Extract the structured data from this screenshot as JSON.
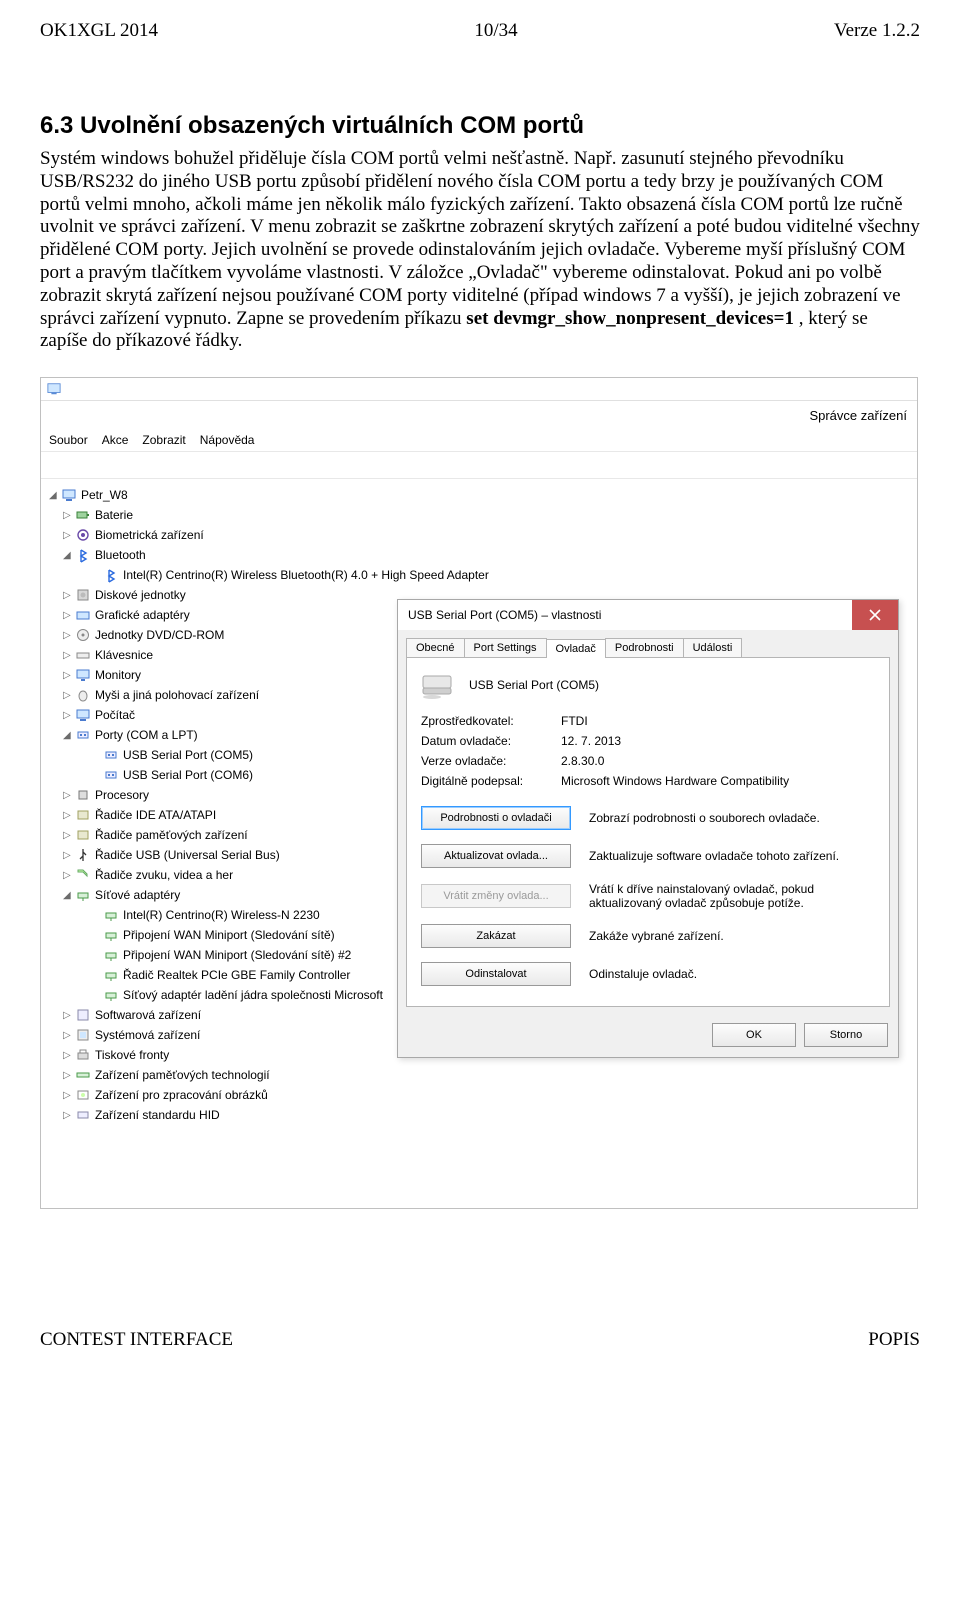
{
  "doc": {
    "header_left": "OK1XGL 2014",
    "header_center": "10/34",
    "header_right": "Verze 1.2.2",
    "section_title": "6.3  Uvolnění obsazených virtuálních COM portů",
    "paragraph_pre": "Systém windows bohužel přiděluje čísla COM portů velmi nešťastně. Např. zasunutí stejného převodníku USB/RS232 do jiného USB portu způsobí přidělení nového čísla COM portu a tedy brzy je používaných COM portů velmi mnoho, ačkoli máme jen několik málo fyzických zařízení. Takto obsazená čísla COM portů lze ručně uvolnit ve správci zařízení. V menu zobrazit se zaškrtne zobrazení skrytých zařízení a poté budou viditelné všechny přidělené COM porty. Jejich uvolnění se provede odinstalováním jejich ovladače. Vybereme myší příslušný COM port a pravým tlačítkem vyvoláme vlastnosti. V záložce „Ovladač\" vybereme odinstalovat. Pokud ani po volbě zobrazit skrytá zařízení nejsou používané COM porty viditelné (případ windows 7 a vyšší), je jejich zobrazení ve správci zařízení vypnuto. Zapne se provedením příkazu ",
    "paragraph_bold": "set devmgr_show_nonpresent_devices=1",
    "paragraph_post": " , který se zapíše do příkazové řádky.",
    "footer_left": "CONTEST INTERFACE",
    "footer_right": "POPIS"
  },
  "devmgr": {
    "app_title": "Správce zařízení",
    "menu": [
      "Soubor",
      "Akce",
      "Zobrazit",
      "Nápověda"
    ],
    "root": "Petr_W8",
    "nodes": [
      {
        "label": "Baterie",
        "expanded": false,
        "icon": "battery"
      },
      {
        "label": "Biometrická zařízení",
        "expanded": false,
        "icon": "bio"
      },
      {
        "label": "Bluetooth",
        "expanded": true,
        "icon": "bt",
        "children": [
          {
            "label": "Intel(R) Centrino(R) Wireless Bluetooth(R) 4.0 + High Speed Adapter",
            "icon": "bt"
          }
        ]
      },
      {
        "label": "Diskové jednotky",
        "expanded": false,
        "icon": "disk"
      },
      {
        "label": "Grafické adaptéry",
        "expanded": false,
        "icon": "gpu"
      },
      {
        "label": "Jednotky DVD/CD-ROM",
        "expanded": false,
        "icon": "cd"
      },
      {
        "label": "Klávesnice",
        "expanded": false,
        "icon": "kb"
      },
      {
        "label": "Monitory",
        "expanded": false,
        "icon": "mon"
      },
      {
        "label": "Myši a jiná polohovací zařízení",
        "expanded": false,
        "icon": "mouse"
      },
      {
        "label": "Počítač",
        "expanded": false,
        "icon": "pc"
      },
      {
        "label": "Porty (COM a LPT)",
        "expanded": true,
        "icon": "port",
        "children": [
          {
            "label": "USB Serial Port (COM5)",
            "icon": "port"
          },
          {
            "label": "USB Serial Port (COM6)",
            "icon": "port"
          }
        ]
      },
      {
        "label": "Procesory",
        "expanded": false,
        "icon": "cpu"
      },
      {
        "label": "Řadiče IDE ATA/ATAPI",
        "expanded": false,
        "icon": "ctrl"
      },
      {
        "label": "Řadiče paměťových zařízení",
        "expanded": false,
        "icon": "ctrl"
      },
      {
        "label": "Řadiče USB (Universal Serial Bus)",
        "expanded": false,
        "icon": "usb"
      },
      {
        "label": "Řadiče zvuku, videa a her",
        "expanded": false,
        "icon": "media"
      },
      {
        "label": "Síťové adaptéry",
        "expanded": true,
        "icon": "net",
        "children": [
          {
            "label": "Intel(R) Centrino(R) Wireless-N 2230",
            "icon": "net"
          },
          {
            "label": "Připojení WAN Miniport (Sledování sítě)",
            "icon": "net"
          },
          {
            "label": "Připojení WAN Miniport (Sledování sítě) #2",
            "icon": "net"
          },
          {
            "label": "Řadič Realtek PCIe GBE Family Controller",
            "icon": "net"
          },
          {
            "label": "Síťový adaptér ladění jádra společnosti Microsoft",
            "icon": "net"
          }
        ]
      },
      {
        "label": "Softwarová zařízení",
        "expanded": false,
        "icon": "sw"
      },
      {
        "label": "Systémová zařízení",
        "expanded": false,
        "icon": "sys"
      },
      {
        "label": "Tiskové fronty",
        "expanded": false,
        "icon": "prn"
      },
      {
        "label": "Zařízení paměťových technologií",
        "expanded": false,
        "icon": "mem"
      },
      {
        "label": "Zařízení pro zpracování obrázků",
        "expanded": false,
        "icon": "img"
      },
      {
        "label": "Zařízení standardu HID",
        "expanded": false,
        "icon": "hid"
      }
    ]
  },
  "dlg": {
    "title": "USB Serial Port (COM5) – vlastnosti",
    "tabs": [
      "Obecné",
      "Port Settings",
      "Ovladač",
      "Podrobnosti",
      "Události"
    ],
    "active_tab": 2,
    "device_name": "USB Serial Port (COM5)",
    "info": [
      {
        "k": "Zprostředkovatel:",
        "v": "FTDI"
      },
      {
        "k": "Datum ovladače:",
        "v": "12. 7. 2013"
      },
      {
        "k": "Verze ovladače:",
        "v": "2.8.30.0"
      },
      {
        "k": "Digitálně podepsal:",
        "v": "Microsoft Windows Hardware Compatibility"
      }
    ],
    "actions": [
      {
        "btn": "Podrobnosti o ovladači",
        "desc": "Zobrazí podrobnosti o souborech ovladače.",
        "state": "focus"
      },
      {
        "btn": "Aktualizovat ovlada...",
        "desc": "Zaktualizuje software ovladače tohoto zařízení.",
        "state": ""
      },
      {
        "btn": "Vrátit změny ovlada...",
        "desc": "Vrátí k dříve nainstalovaný ovladač, pokud aktualizovaný ovladač způsobuje potíže.",
        "state": "disabled"
      },
      {
        "btn": "Zakázat",
        "desc": "Zakáže vybrané zařízení.",
        "state": ""
      },
      {
        "btn": "Odinstalovat",
        "desc": "Odinstaluje ovladač.",
        "state": ""
      }
    ],
    "footer": {
      "ok": "OK",
      "cancel": "Storno"
    }
  }
}
